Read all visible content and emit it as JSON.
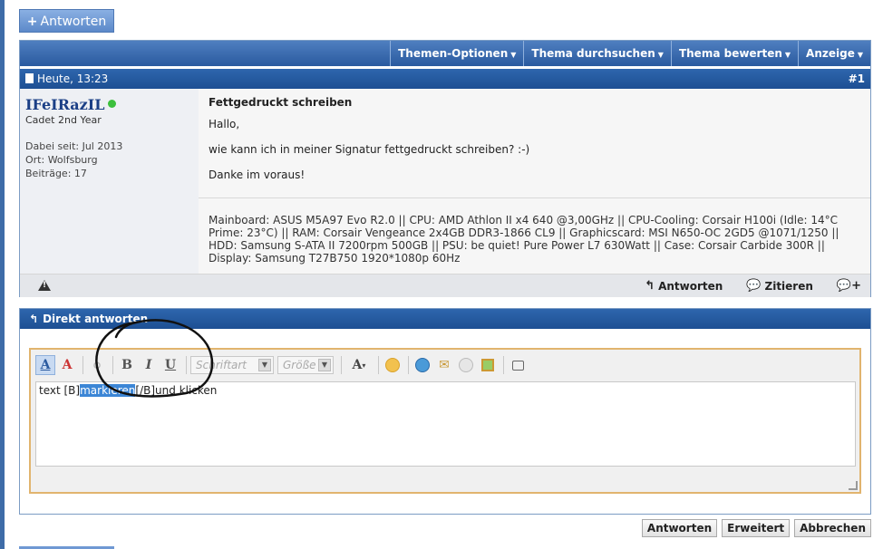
{
  "top_button": {
    "label": "Antworten",
    "icon": "plus-icon"
  },
  "thread_toolbar": {
    "items": [
      "Themen-Optionen",
      "Thema durchsuchen",
      "Thema bewerten",
      "Anzeige"
    ]
  },
  "post": {
    "date": "Heute, 13:23",
    "number": "#1",
    "user": {
      "name": "IFeIRazIL",
      "title": "Cadet 2nd Year",
      "joined": "Dabei seit: Jul 2013",
      "location": "Ort: Wolfsburg",
      "posts": "Beiträge: 17",
      "online_color": "#3cbf3c"
    },
    "title": "Fettgedruckt schreiben",
    "body": [
      "Hallo,",
      "wie kann ich in meiner Signatur fettgedruckt schreiben? :-)",
      "Danke im voraus!"
    ],
    "signature": "Mainboard: ASUS M5A97 Evo R2.0 || CPU: AMD Athlon II x4 640 @3,00GHz || CPU-Cooling: Corsair H100i (Idle: 14°C Prime: 23°C) || RAM: Corsair Vengeance 2x4GB DDR3-1866 CL9 || Graphicscard: MSI N650-OC 2GD5 @1071/1250 || HDD: Samsung S-ATA II 7200rpm 500GB || PSU: be quiet! Pure Power L7 630Watt || Case: Corsair Carbide 300R || Display: Samsung T27B750 1920*1080p 60Hz",
    "footer": {
      "reply": "Antworten",
      "quote": "Zitieren"
    }
  },
  "quick_reply": {
    "title": "Direkt antworten",
    "font_select": "Schriftart",
    "size_select": "Größe",
    "text_before": "text [B]",
    "text_selected": "markieren",
    "text_after": "[/B]und klicken"
  },
  "buttons": {
    "submit": "Antworten",
    "advanced": "Erweitert",
    "cancel": "Abbrechen"
  },
  "colors": {
    "header_blue": "#2e66ad",
    "editor_border": "#e1b46e",
    "selection": "#3c86d6"
  }
}
